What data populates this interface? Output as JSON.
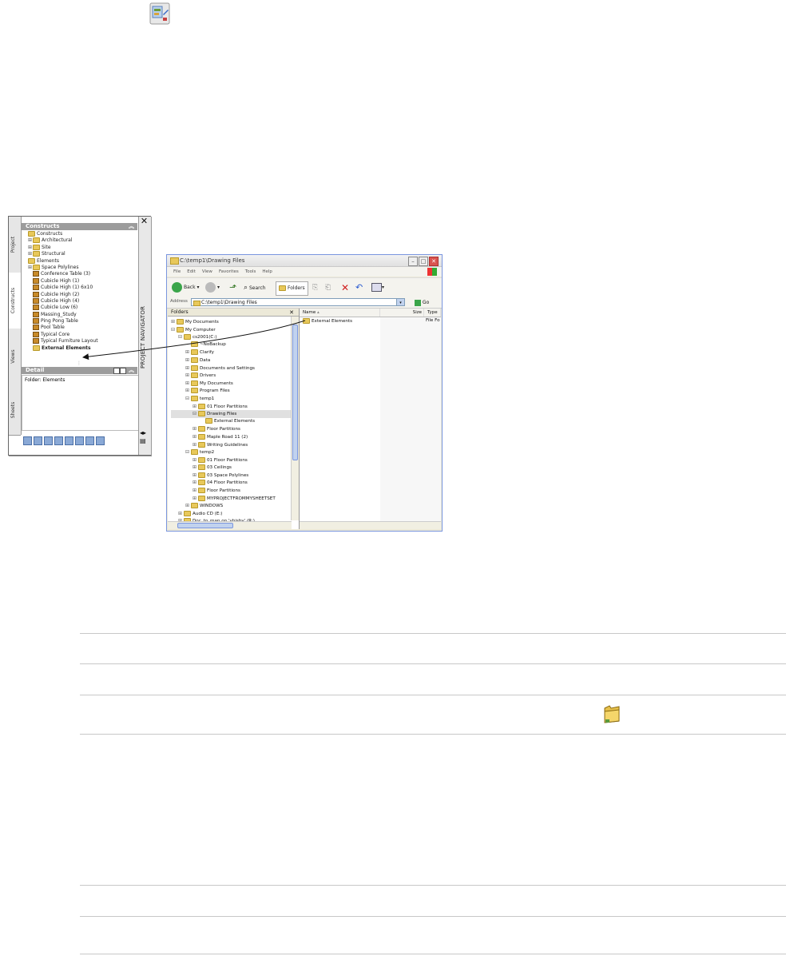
{
  "project_navigator": {
    "constructs_header": "Constructs",
    "tabs": [
      "Project",
      "Constructs",
      "Views",
      "Sheets"
    ],
    "vertical_title": "PROJECT NAVIGATOR",
    "close_glyph": "✕",
    "tree": [
      {
        "label": "Constructs",
        "toggle": "",
        "icon": "folder",
        "indent": 0
      },
      {
        "label": "Architectural",
        "toggle": "⊞",
        "icon": "folder",
        "indent": 1
      },
      {
        "label": "Site",
        "toggle": "⊞",
        "icon": "folder",
        "indent": 1
      },
      {
        "label": "Structural",
        "toggle": "⊞",
        "icon": "folder",
        "indent": 1
      },
      {
        "label": "Elements",
        "toggle": "",
        "icon": "folder",
        "indent": 0
      },
      {
        "label": "Space Polylines",
        "toggle": "⊞",
        "icon": "folder",
        "indent": 1
      },
      {
        "label": "Conference Table (3)",
        "toggle": "",
        "icon": "element",
        "indent": 1
      },
      {
        "label": "Cubicle High (1)",
        "toggle": "",
        "icon": "element",
        "indent": 1
      },
      {
        "label": "Cubicle High (1) 6x10",
        "toggle": "",
        "icon": "element",
        "indent": 1
      },
      {
        "label": "Cubicle High (2)",
        "toggle": "",
        "icon": "element",
        "indent": 1
      },
      {
        "label": "Cubicle High (4)",
        "toggle": "",
        "icon": "element",
        "indent": 1
      },
      {
        "label": "Cubicle Low (6)",
        "toggle": "",
        "icon": "element",
        "indent": 1
      },
      {
        "label": "Massing_Study",
        "toggle": "",
        "icon": "element",
        "indent": 1
      },
      {
        "label": "Ping Pong Table",
        "toggle": "",
        "icon": "element",
        "indent": 1
      },
      {
        "label": "Pool Table",
        "toggle": "",
        "icon": "element",
        "indent": 1
      },
      {
        "label": "Typical Core",
        "toggle": "",
        "icon": "element",
        "indent": 1
      },
      {
        "label": "Typical Furniture Layout",
        "toggle": "",
        "icon": "element",
        "indent": 1
      },
      {
        "label": "External Elements",
        "toggle": "",
        "icon": "folder",
        "indent": 1
      }
    ],
    "detail_header": "Detail",
    "detail_text": "Folder: Elements"
  },
  "explorer": {
    "title": "C:\\temp1\\Drawing Files",
    "menu": [
      "File",
      "Edit",
      "View",
      "Favorites",
      "Tools",
      "Help"
    ],
    "toolbar": {
      "back": "Back",
      "search": "Search",
      "folders": "Folders"
    },
    "address_label": "Address",
    "address_value": "C:\\temp1\\Drawing Files",
    "go_label": "Go",
    "folders_header": "Folders",
    "folder_tree": [
      {
        "label": "My Documents",
        "toggle": "⊞",
        "indent": 0
      },
      {
        "label": "My Computer",
        "toggle": "⊟",
        "indent": 0
      },
      {
        "label": "cs2001(C:)",
        "toggle": "⊟",
        "indent": 1
      },
      {
        "label": "~NoBackup",
        "toggle": "",
        "indent": 2
      },
      {
        "label": "Clarify",
        "toggle": "⊞",
        "indent": 2
      },
      {
        "label": "Data",
        "toggle": "⊞",
        "indent": 2
      },
      {
        "label": "Documents and Settings",
        "toggle": "⊞",
        "indent": 2
      },
      {
        "label": "Drivers",
        "toggle": "⊞",
        "indent": 2
      },
      {
        "label": "My Documents",
        "toggle": "⊞",
        "indent": 2
      },
      {
        "label": "Program Files",
        "toggle": "⊞",
        "indent": 2
      },
      {
        "label": "temp1",
        "toggle": "⊟",
        "indent": 2
      },
      {
        "label": "01 Floor Partitions",
        "toggle": "⊞",
        "indent": 3
      },
      {
        "label": "Drawing Files",
        "toggle": "⊟",
        "indent": 3
      },
      {
        "label": "External Elements",
        "toggle": "",
        "indent": 4
      },
      {
        "label": "Floor Partitions",
        "toggle": "⊞",
        "indent": 3
      },
      {
        "label": "Maple Road 11 (2)",
        "toggle": "⊞",
        "indent": 3
      },
      {
        "label": "Writing Guidelines",
        "toggle": "⊞",
        "indent": 3
      },
      {
        "label": "temp2",
        "toggle": "⊟",
        "indent": 2
      },
      {
        "label": "01 Floor Partitions",
        "toggle": "⊞",
        "indent": 3
      },
      {
        "label": "03 Ceilings",
        "toggle": "⊞",
        "indent": 3
      },
      {
        "label": "03 Space Polylines",
        "toggle": "⊞",
        "indent": 3
      },
      {
        "label": "04 Floor Partitions",
        "toggle": "⊞",
        "indent": 3
      },
      {
        "label": "Floor Partitions",
        "toggle": "⊞",
        "indent": 3
      },
      {
        "label": "MYPROJECTFROMMYSHEETSET",
        "toggle": "⊞",
        "indent": 3
      },
      {
        "label": "WINDOWS",
        "toggle": "⊞",
        "indent": 2
      },
      {
        "label": "Audio CD (E:)",
        "toggle": "⊞",
        "indent": 1
      },
      {
        "label": "Doc_to_map on 'vhisby' (R:)",
        "toggle": "⊞",
        "indent": 1
      }
    ],
    "columns": {
      "name": "Name",
      "size": "Size",
      "type": "Type"
    },
    "files": [
      {
        "name": "External Elements",
        "type": "File Fo"
      }
    ]
  }
}
